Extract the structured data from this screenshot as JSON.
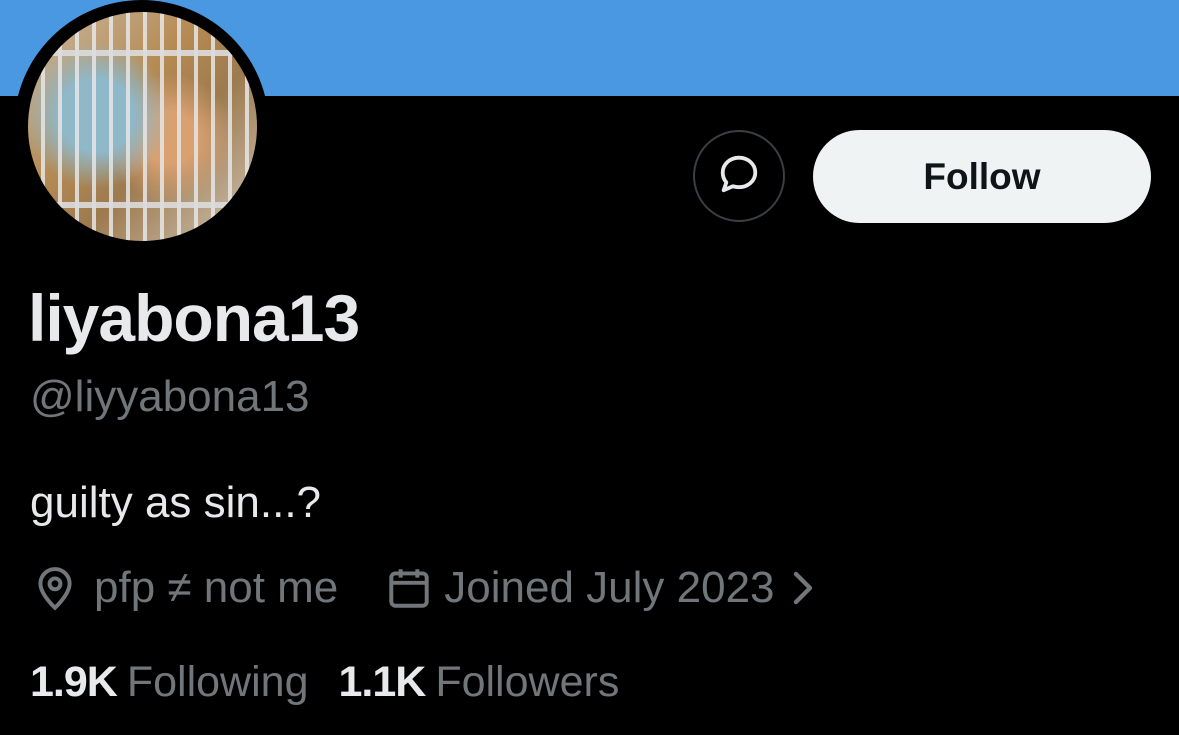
{
  "profile": {
    "display_name": "liyabona13",
    "handle": "@liyyabona13",
    "bio": "guilty as sin...?",
    "location": "pfp ≠ not me",
    "joined": "Joined July 2023",
    "avatar_icon": "avatar-image",
    "banner_color": "#4a98e2"
  },
  "actions": {
    "message_icon": "message-bubble-icon",
    "follow_label": "Follow"
  },
  "stats": {
    "following_count": "1.9K",
    "following_label": "Following",
    "followers_count": "1.1K",
    "followers_label": "Followers"
  }
}
